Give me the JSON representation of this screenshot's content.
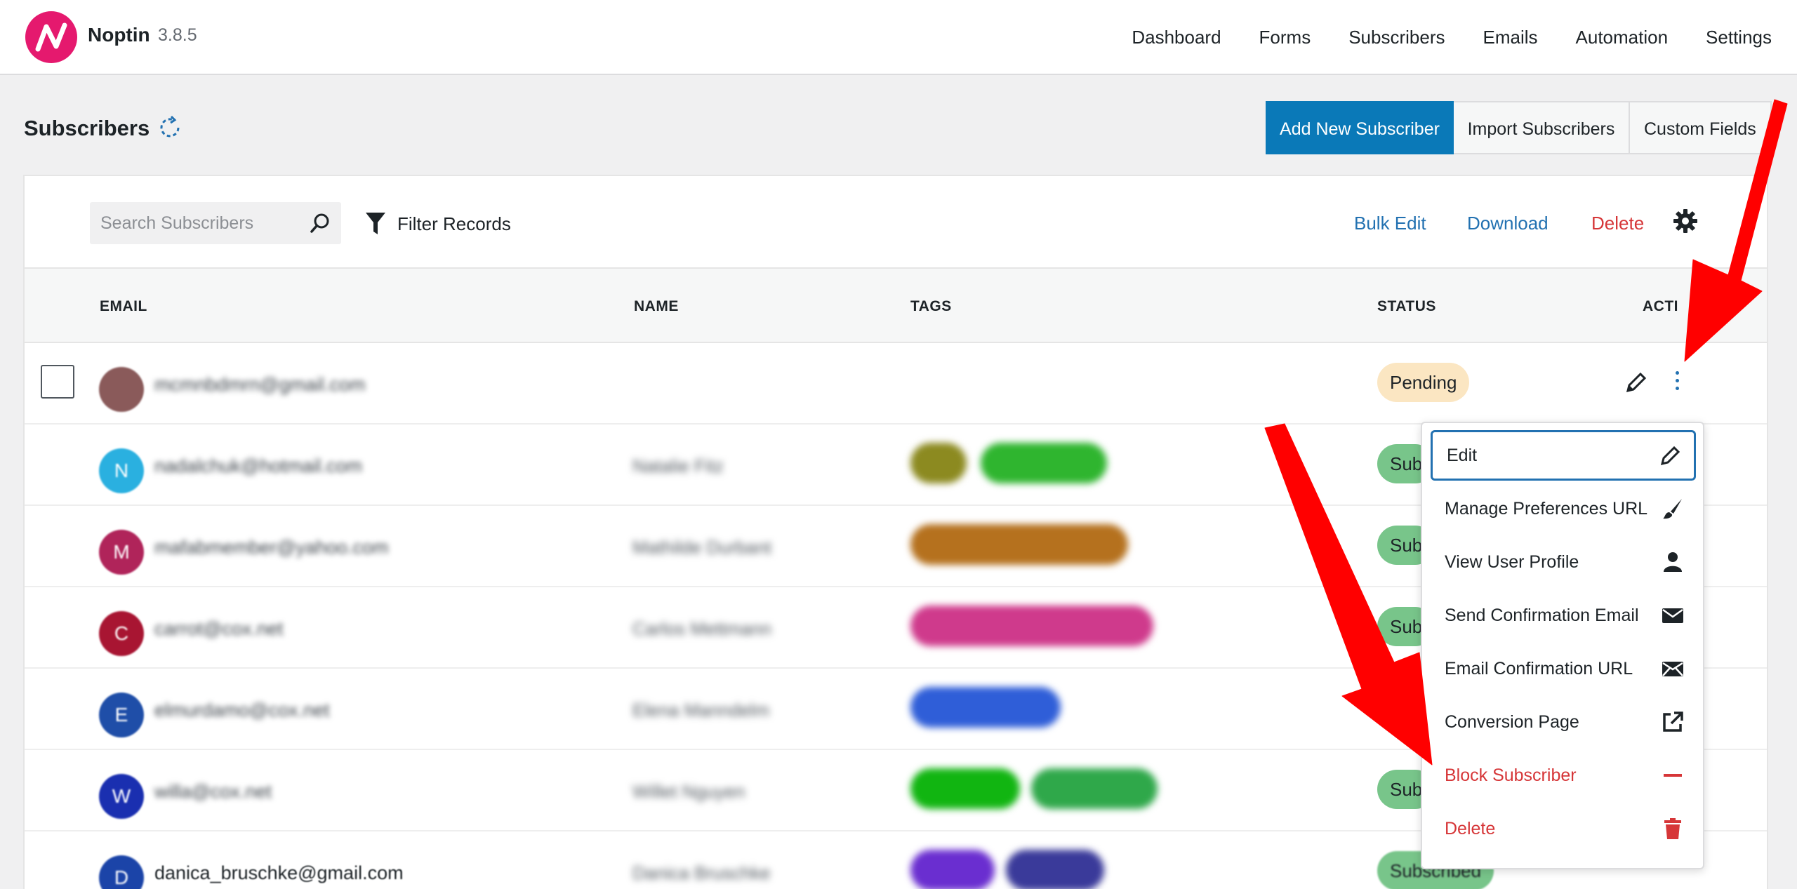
{
  "app": {
    "name": "Noptin",
    "version": "3.8.5"
  },
  "top_nav": [
    "Dashboard",
    "Forms",
    "Subscribers",
    "Emails",
    "Automation",
    "Settings"
  ],
  "page": {
    "title": "Subscribers",
    "buttons": {
      "add": "Add New Subscriber",
      "import": "Import Subscribers",
      "fields": "Custom Fields"
    }
  },
  "toolbar": {
    "search_placeholder": "Search Subscribers",
    "filter": "Filter Records",
    "bulk_edit": "Bulk Edit",
    "download": "Download",
    "delete": "Delete"
  },
  "table": {
    "columns": [
      "EMAIL",
      "NAME",
      "TAGS",
      "STATUS",
      "ACTI"
    ],
    "rows": [
      {
        "initial": "",
        "email": "mcmnbdmrn@gmail.com",
        "name": "",
        "status": "Pending",
        "avatar_color": "#8a5a5a"
      },
      {
        "initial": "N",
        "email": "nadalchuk@hotmail.com",
        "name": "Natalie Fitz",
        "status": "Sub",
        "avatar_color": "#2ab0e0"
      },
      {
        "initial": "M",
        "email": "mafabmember@yahoo.com",
        "name": "Mathilde Durbant",
        "status": "Sub",
        "avatar_color": "#b0245a"
      },
      {
        "initial": "C",
        "email": "carrot@cox.net",
        "name": "Carlos Mettmann",
        "status": "Sub",
        "avatar_color": "#a81532"
      },
      {
        "initial": "E",
        "email": "elmurdamo@cox.net",
        "name": "Elena Manndelm",
        "status": "",
        "avatar_color": "#1f4ea8"
      },
      {
        "initial": "W",
        "email": "willa@cox.net",
        "name": "Willet Nguyen",
        "status": "Sub",
        "avatar_color": "#1a2fb0"
      },
      {
        "initial": "D",
        "email": "danica_bruschke@gmail.com",
        "name": "Danica Bruschke",
        "status": "Subscribed",
        "avatar_color": "#1b44a8"
      }
    ]
  },
  "menu": [
    {
      "label": "Edit",
      "icon": "pencil-icon"
    },
    {
      "label": "Manage Preferences URL",
      "icon": "brush-icon"
    },
    {
      "label": "View User Profile",
      "icon": "user-icon"
    },
    {
      "label": "Send Confirmation Email",
      "icon": "envelope-icon"
    },
    {
      "label": "Email Confirmation URL",
      "icon": "envelope-open-icon"
    },
    {
      "label": "Conversion Page",
      "icon": "external-link-icon"
    },
    {
      "label": "Block Subscriber",
      "icon": "minus-icon"
    },
    {
      "label": "Delete",
      "icon": "trash-icon"
    }
  ],
  "colors": {
    "primary": "#0a79b8",
    "danger": "#d63638",
    "link": "#2271b1",
    "brand": "#e5196e",
    "arrow": "#ff0000"
  }
}
